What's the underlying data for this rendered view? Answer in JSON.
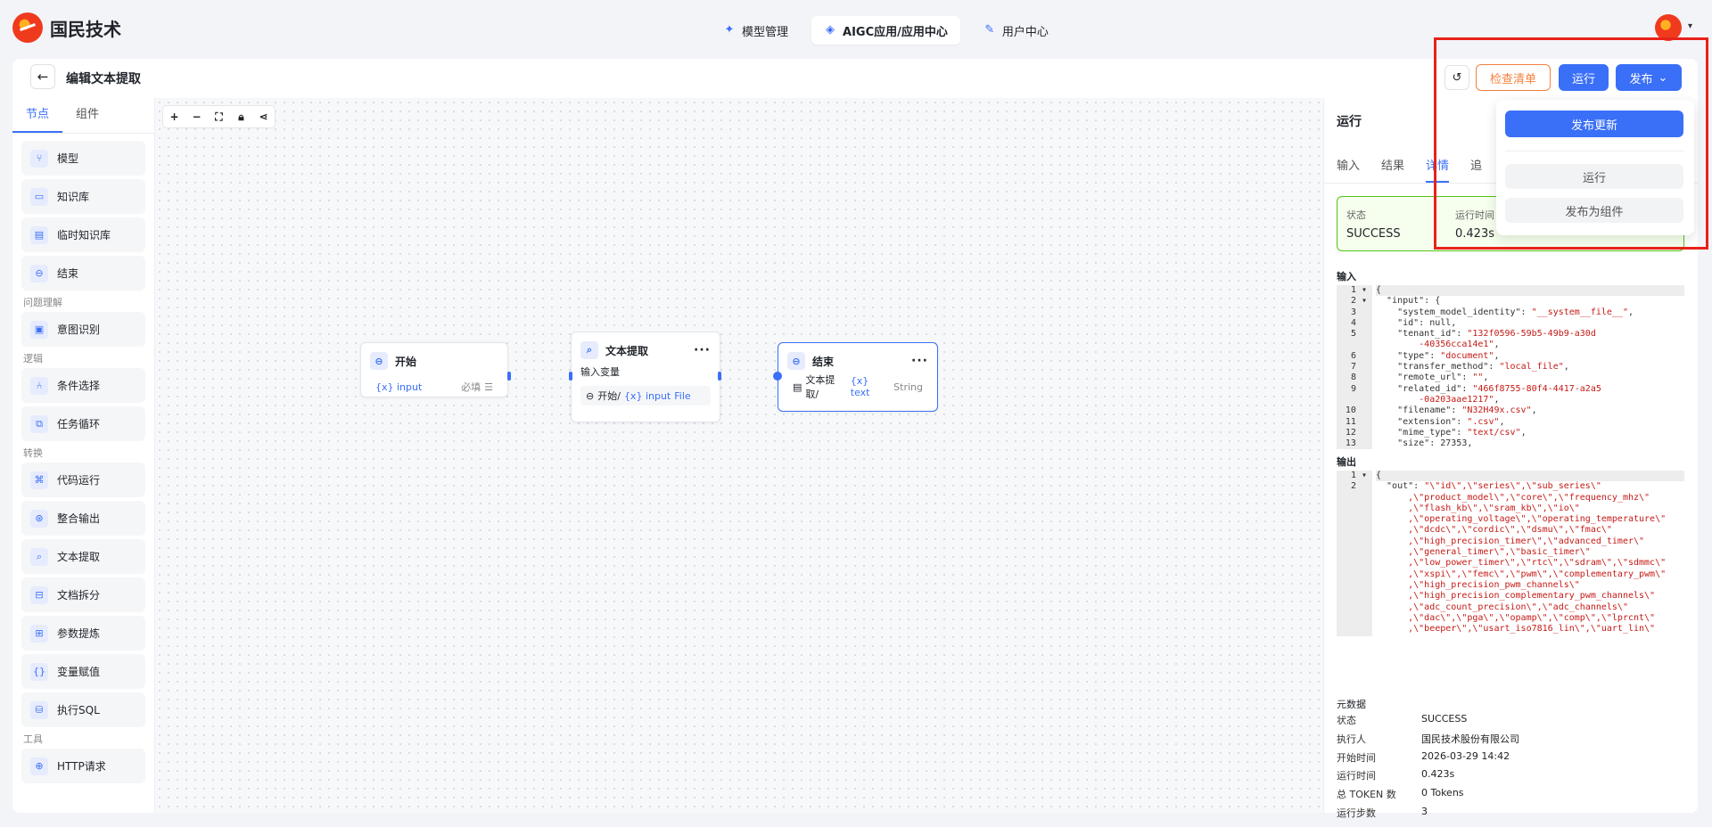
{
  "brand": {
    "name": "国民技术"
  },
  "nav": {
    "tabs": [
      {
        "label": "模型管理",
        "icon": "sparkle-icon"
      },
      {
        "label": "AIGC应用/应用中心",
        "icon": "app-icon"
      },
      {
        "label": "用户中心",
        "icon": "user-icon"
      }
    ]
  },
  "header": {
    "title": "编辑文本提取",
    "check_label": "检查清单",
    "run_label": "运行",
    "publish_label": "发布"
  },
  "sidebar": {
    "tabs": [
      "节点",
      "组件"
    ],
    "items": [
      "模型",
      "知识库",
      "临时知识库",
      "结束"
    ],
    "groups": {
      "understanding": "问题理解",
      "logic": "逻辑",
      "transform": "转换",
      "tools": "工具"
    },
    "understanding_items": [
      "意图识别"
    ],
    "logic_items": [
      "条件选择",
      "任务循环"
    ],
    "transform_items": [
      "代码运行",
      "整合输出",
      "文本提取",
      "文档拆分",
      "参数提炼",
      "变量赋值",
      "执行SQL"
    ],
    "tool_items": [
      "HTTP请求"
    ]
  },
  "canvas": {
    "nodes": {
      "start": {
        "title": "开始",
        "var": "{x} input",
        "req": "必填"
      },
      "extract": {
        "title": "文本提取",
        "sub": "输入变量",
        "src": "开始/",
        "var": "{x} input",
        "type": "File",
        "more": "···"
      },
      "end": {
        "title": "结束",
        "src": "文本提取/",
        "var": "{x} text",
        "type": "String",
        "more": "···"
      }
    }
  },
  "panel": {
    "title": "运行",
    "tabs": [
      "输入",
      "结果",
      "详情",
      "追"
    ],
    "status": {
      "status_label": "状态",
      "status_value": "SUCCESS",
      "time_label": "运行时间",
      "time_value": "0.423s",
      "tokens_value": "0 Tokens"
    },
    "input_label": "输入",
    "output_label": "输出",
    "meta_label": "元数据",
    "meta": [
      {
        "k": "状态",
        "v": "SUCCESS"
      },
      {
        "k": "执行人",
        "v": "国民技术股份有限公司"
      },
      {
        "k": "开始时间",
        "v": "2026-03-29 14:42"
      },
      {
        "k": "运行时间",
        "v": "0.423s"
      },
      {
        "k": "总 TOKEN 数",
        "v": "0 Tokens"
      },
      {
        "k": "运行步数",
        "v": "3"
      }
    ]
  },
  "input_code": [
    {
      "n": "1",
      "t": "{"
    },
    {
      "n": "2",
      "t": "  \"input\": {"
    },
    {
      "n": "3",
      "t": "    \"system_model_identity\": ",
      "s": "\"__system__file__\"",
      "e": ","
    },
    {
      "n": "4",
      "t": "    \"id\": null,"
    },
    {
      "n": "5",
      "t": "    \"tenant_id\": ",
      "s": "\"132f0596-59b5-49b9-a30d",
      "e": ""
    },
    {
      "n": "",
      "t": "",
      "s": "        -40356cca14e1\"",
      "e": ","
    },
    {
      "n": "6",
      "t": "    \"type\": ",
      "s": "\"document\"",
      "e": ","
    },
    {
      "n": "7",
      "t": "    \"transfer_method\": ",
      "s": "\"local_file\"",
      "e": ","
    },
    {
      "n": "8",
      "t": "    \"remote_url\": ",
      "s": "\"\"",
      "e": ","
    },
    {
      "n": "9",
      "t": "    \"related_id\": ",
      "s": "\"466f8755-80f4-4417-a2a5",
      "e": ""
    },
    {
      "n": "",
      "t": "",
      "s": "        -0a203aae1217\"",
      "e": ","
    },
    {
      "n": "10",
      "t": "    \"filename\": ",
      "s": "\"N32H49x.csv\"",
      "e": ","
    },
    {
      "n": "11",
      "t": "    \"extension\": ",
      "s": "\".csv\"",
      "e": ","
    },
    {
      "n": "12",
      "t": "    \"mime_type\": ",
      "s": "\"text/csv\"",
      "e": ","
    },
    {
      "n": "13",
      "t": "    \"size\": 27353,"
    }
  ],
  "output_code": [
    {
      "n": "1",
      "t": "{"
    },
    {
      "n": "2",
      "t": "  \"out\": ",
      "s": "\"\\\"id\\\",\\\"series\\\",\\\"sub_series\\\"",
      "e": ""
    },
    {
      "n": "",
      "t": "",
      "s": "      ,\\\"product_model\\\",\\\"core\\\",\\\"frequency_mhz\\\"",
      "e": ""
    },
    {
      "n": "",
      "t": "",
      "s": "      ,\\\"flash_kb\\\",\\\"sram_kb\\\",\\\"io\\\"",
      "e": ""
    },
    {
      "n": "",
      "t": "",
      "s": "      ,\\\"operating_voltage\\\",\\\"operating_temperature\\\"",
      "e": ""
    },
    {
      "n": "",
      "t": "",
      "s": "      ,\\\"dcdc\\\",\\\"cordic\\\",\\\"dsmu\\\",\\\"fmac\\\"",
      "e": ""
    },
    {
      "n": "",
      "t": "",
      "s": "      ,\\\"high_precision_timer\\\",\\\"advanced_timer\\\"",
      "e": ""
    },
    {
      "n": "",
      "t": "",
      "s": "      ,\\\"general_timer\\\",\\\"basic_timer\\\"",
      "e": ""
    },
    {
      "n": "",
      "t": "",
      "s": "      ,\\\"low_power_timer\\\",\\\"rtc\\\",\\\"sdram\\\",\\\"sdmmc\\\"",
      "e": ""
    },
    {
      "n": "",
      "t": "",
      "s": "      ,\\\"xspi\\\",\\\"femc\\\",\\\"pwm\\\",\\\"complementary_pwm\\\"",
      "e": ""
    },
    {
      "n": "",
      "t": "",
      "s": "      ,\\\"high_precision_pwm_channels\\\"",
      "e": ""
    },
    {
      "n": "",
      "t": "",
      "s": "      ,\\\"high_precision_complementary_pwm_channels\\\"",
      "e": ""
    },
    {
      "n": "",
      "t": "",
      "s": "      ,\\\"adc_count_precision\\\",\\\"adc_channels\\\"",
      "e": ""
    },
    {
      "n": "",
      "t": "",
      "s": "      ,\\\"dac\\\",\\\"pga\\\",\\\"opamp\\\",\\\"comp\\\",\\\"lprcnt\\\"",
      "e": ""
    },
    {
      "n": "",
      "t": "",
      "s": "      ,\\\"beeper\\\",\\\"usart_iso7816_lin\\\",\\\"uart_lin\\\"",
      "e": ""
    }
  ],
  "dropdown": {
    "primary": "发布更新",
    "items": [
      "运行",
      "发布为组件"
    ]
  }
}
